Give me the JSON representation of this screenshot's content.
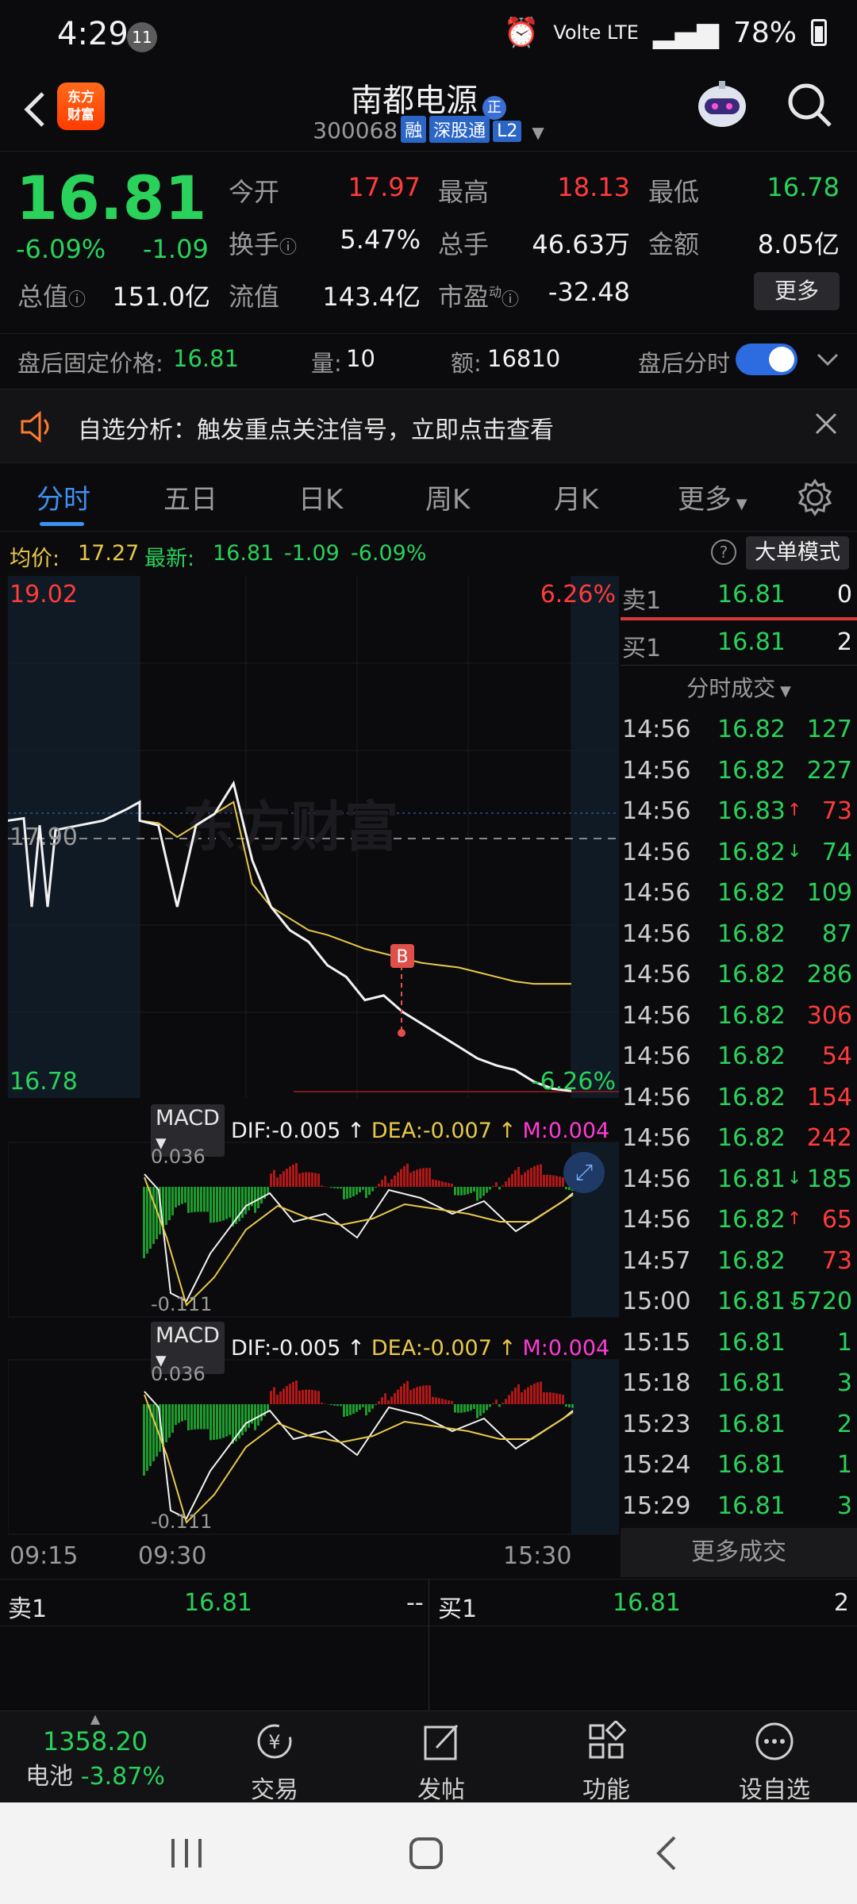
{
  "status_bar": {
    "time": "4:29",
    "notif_count": "11",
    "network": "Volte LTE",
    "battery": "78%"
  },
  "header": {
    "title": "南都电源",
    "title_badge": "正",
    "code": "300068",
    "tags": [
      "融",
      "深股通",
      "L2"
    ],
    "logo_text": "东方财富"
  },
  "quote": {
    "price": "16.81",
    "change_pct": "-6.09%",
    "change": "-1.09",
    "fields": [
      {
        "label": "今开",
        "value": "17.97",
        "color": "#ff3b3b"
      },
      {
        "label": "最高",
        "value": "18.13",
        "color": "#ff3b3b"
      },
      {
        "label": "最低",
        "value": "16.78",
        "color": "#2ad15a"
      },
      {
        "label": "换手",
        "value": "5.47%",
        "color": "#f2f2f2"
      },
      {
        "label": "总手",
        "value": "46.63万",
        "color": "#f2f2f2"
      },
      {
        "label": "金额",
        "value": "8.05亿",
        "color": "#f2f2f2"
      },
      {
        "label": "总值",
        "value": "151.0亿",
        "color": "#f2f2f2"
      },
      {
        "label": "流值",
        "value": "143.4亿",
        "color": "#f2f2f2"
      },
      {
        "label": "市盈",
        "value": "-32.48",
        "color": "#f2f2f2"
      }
    ],
    "pe_sup": "动",
    "more": "更多"
  },
  "after_hours": {
    "label": "盘后固定价格:",
    "price": "16.81",
    "vol_label": "量:",
    "vol": "10",
    "amt_label": "额:",
    "amt": "16810",
    "toggle_label": "盘后分时"
  },
  "alert": {
    "text": "自选分析：触发重点关注信号，立即点击查看"
  },
  "tabs": [
    "分时",
    "五日",
    "日K",
    "周K",
    "月K",
    "更多"
  ],
  "info_line": {
    "avg_label": "均价:",
    "avg": "17.27",
    "latest_label": "最新:",
    "latest": "16.81",
    "chg": "-1.09",
    "pct": "-6.09%",
    "mode": "大单模式"
  },
  "chart": {
    "y_top": "19.02",
    "y_top_pct": "6.26%",
    "y_mid": "17.90",
    "y_bot": "16.78",
    "y_bot_pct": "-6.26%",
    "marker": "B",
    "watermark": "东方财富",
    "x_labels": [
      "09:15",
      "09:30",
      "15:30"
    ],
    "macd": {
      "chip": "MACD",
      "dif": "DIF:-0.005",
      "dea": "DEA:-0.007",
      "m": "M:0.004",
      "top": "0.036",
      "bottom": "-0.111"
    }
  },
  "chart_data": {
    "type": "line",
    "title": "",
    "ylim": [
      16.78,
      19.02
    ],
    "series": [
      {
        "values": [
          17.97,
          17.95,
          17.6,
          17.95,
          18.0,
          18.13,
          17.8,
          17.6,
          17.5,
          17.45,
          17.35,
          17.3,
          17.2,
          17.22,
          17.15,
          17.1,
          17.05,
          17.0,
          16.95,
          16.92,
          16.9,
          16.85,
          16.82,
          16.81
        ]
      },
      {
        "values": [
          17.97,
          17.96,
          17.9,
          17.95,
          18.0,
          18.05,
          17.7,
          17.6,
          17.55,
          17.5,
          17.48,
          17.45,
          17.42,
          17.4,
          17.38,
          17.36,
          17.35,
          17.34,
          17.32,
          17.3,
          17.28,
          17.27,
          17.27,
          17.27
        ]
      }
    ]
  },
  "side_panel": {
    "sell1": {
      "label": "卖1",
      "price": "16.81",
      "vol": "0"
    },
    "buy1": {
      "label": "买1",
      "price": "16.81",
      "vol": "2"
    },
    "trades_title": "分时成交",
    "trades": [
      {
        "t": "14:56",
        "p": "16.82",
        "v": "127",
        "c": "#2ad15a",
        "a": ""
      },
      {
        "t": "14:56",
        "p": "16.82",
        "v": "227",
        "c": "#2ad15a",
        "a": ""
      },
      {
        "t": "14:56",
        "p": "16.83",
        "v": "73",
        "c": "#ff3b3b",
        "a": "↑"
      },
      {
        "t": "14:56",
        "p": "16.82",
        "v": "74",
        "c": "#2ad15a",
        "a": "↓"
      },
      {
        "t": "14:56",
        "p": "16.82",
        "v": "109",
        "c": "#2ad15a",
        "a": ""
      },
      {
        "t": "14:56",
        "p": "16.82",
        "v": "87",
        "c": "#2ad15a",
        "a": ""
      },
      {
        "t": "14:56",
        "p": "16.82",
        "v": "286",
        "c": "#2ad15a",
        "a": ""
      },
      {
        "t": "14:56",
        "p": "16.82",
        "v": "306",
        "c": "#ff3b3b",
        "a": ""
      },
      {
        "t": "14:56",
        "p": "16.82",
        "v": "54",
        "c": "#ff3b3b",
        "a": ""
      },
      {
        "t": "14:56",
        "p": "16.82",
        "v": "154",
        "c": "#ff3b3b",
        "a": ""
      },
      {
        "t": "14:56",
        "p": "16.82",
        "v": "242",
        "c": "#ff3b3b",
        "a": ""
      },
      {
        "t": "14:56",
        "p": "16.81",
        "v": "185",
        "c": "#2ad15a",
        "a": "↓"
      },
      {
        "t": "14:56",
        "p": "16.82",
        "v": "65",
        "c": "#ff3b3b",
        "a": "↑"
      },
      {
        "t": "14:57",
        "p": "16.82",
        "v": "73",
        "c": "#ff3b3b",
        "a": ""
      },
      {
        "t": "15:00",
        "p": "16.81",
        "v": "5720",
        "c": "#2ad15a",
        "a": "↓"
      },
      {
        "t": "15:15",
        "p": "16.81",
        "v": "1",
        "c": "#2ad15a",
        "a": ""
      },
      {
        "t": "15:18",
        "p": "16.81",
        "v": "3",
        "c": "#2ad15a",
        "a": ""
      },
      {
        "t": "15:23",
        "p": "16.81",
        "v": "2",
        "c": "#2ad15a",
        "a": ""
      },
      {
        "t": "15:24",
        "p": "16.81",
        "v": "1",
        "c": "#2ad15a",
        "a": ""
      },
      {
        "t": "15:29",
        "p": "16.81",
        "v": "3",
        "c": "#2ad15a",
        "a": ""
      }
    ],
    "more_trades": "更多成交"
  },
  "bottom_book": {
    "sell_label": "卖1",
    "sell_price": "16.81",
    "sell_vol": "--",
    "buy_label": "买1",
    "buy_price": "16.81",
    "buy_vol": "2"
  },
  "bottom_nav": {
    "index_value": "1358.20",
    "index_name": "电池",
    "index_pct": "-3.87%",
    "items": [
      "交易",
      "发帖",
      "功能",
      "设自选"
    ]
  },
  "colors": {
    "up": "#ff3b3b",
    "down": "#2ad15a",
    "accent": "#3f8ff0",
    "avg_line": "#e8c84a"
  }
}
